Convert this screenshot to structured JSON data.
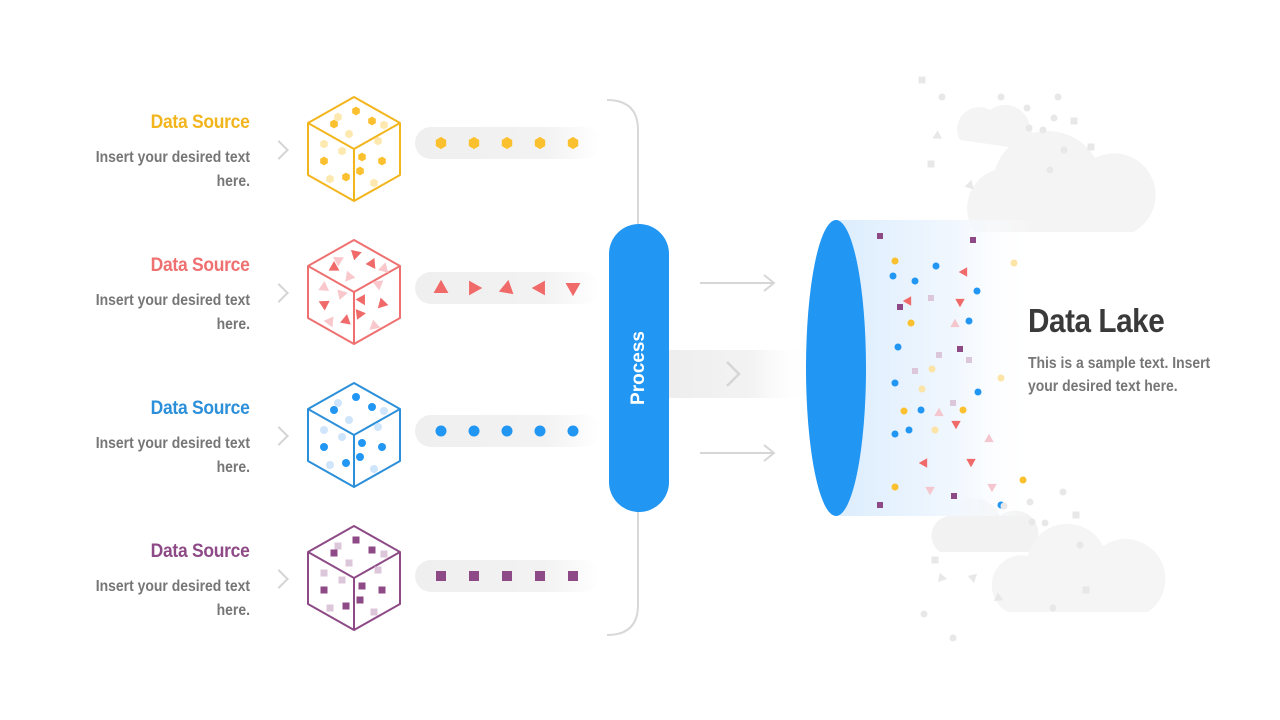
{
  "sources": [
    {
      "title": "Data Source",
      "description": "Insert your desired text here.",
      "color": "#f2b51d",
      "token_color": "#fbc02d",
      "light_color": "#fde9b0",
      "token_shape": "hexagon"
    },
    {
      "title": "Data Source",
      "description": "Insert your desired text here.",
      "color": "#ef7070",
      "token_color": "#f06a6a",
      "light_color": "#f8c8cc",
      "token_shape": "triangle"
    },
    {
      "title": "Data Source",
      "description": "Insert your desired text here.",
      "color": "#2c8fd9",
      "token_color": "#2196f3",
      "light_color": "#cfe5fb",
      "token_shape": "circle"
    },
    {
      "title": "Data Source",
      "description": "Insert your desired text here.",
      "color": "#8e4a86",
      "token_color": "#8e4a86",
      "light_color": "#dcc6d9",
      "token_shape": "square"
    }
  ],
  "process": {
    "label": "Process",
    "color": "#2196f3"
  },
  "lake": {
    "title": "Data Lake",
    "description": "This is a sample text. Insert your desired text here.",
    "color": "#2196f3"
  },
  "colors": {
    "neutral_line": "#d6d6d6",
    "cloud": "#f3f3f3",
    "text_gray": "#767676",
    "heading": "#3a3a3a"
  }
}
